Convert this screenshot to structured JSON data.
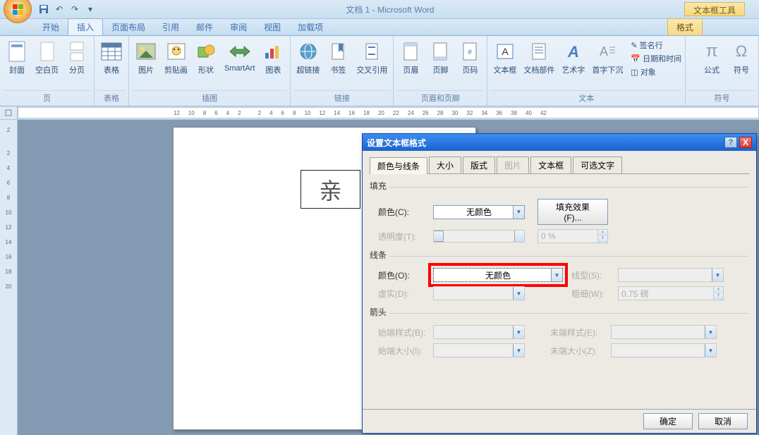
{
  "title": "文档 1 - Microsoft Word",
  "context_tool": "文本框工具",
  "qat": {
    "save": "save-icon",
    "undo": "undo-icon",
    "redo": "redo-icon"
  },
  "tabs": {
    "home": "开始",
    "insert": "插入",
    "layout": "页面布局",
    "ref": "引用",
    "mail": "邮件",
    "review": "审阅",
    "view": "视图",
    "addin": "加载项",
    "format": "格式"
  },
  "ribbon": {
    "groups": {
      "page": {
        "label": "页",
        "items": [
          "封面",
          "空白页",
          "分页"
        ]
      },
      "table": {
        "label": "表格",
        "items": [
          "表格"
        ]
      },
      "illus": {
        "label": "插图",
        "items": [
          "图片",
          "剪贴画",
          "形状",
          "SmartArt",
          "图表"
        ]
      },
      "links": {
        "label": "链接",
        "items": [
          "超链接",
          "书签",
          "交叉引用"
        ]
      },
      "hf": {
        "label": "页眉和页脚",
        "items": [
          "页眉",
          "页脚",
          "页码"
        ]
      },
      "text": {
        "label": "文本",
        "items": [
          "文本框",
          "文档部件",
          "艺术字",
          "首字下沉"
        ],
        "small": [
          "签名行",
          "日期和时间",
          "对象"
        ]
      },
      "sym": {
        "label": "符号",
        "items": [
          "公式",
          "符号"
        ]
      }
    }
  },
  "ruler_h": [
    "12",
    "10",
    "8",
    "6",
    "4",
    "2",
    "",
    "2",
    "4",
    "6",
    "8",
    "10",
    "12",
    "14",
    "16",
    "18",
    "20",
    "22",
    "24",
    "26",
    "28",
    "30",
    "32",
    "34",
    "36",
    "38",
    "40",
    "42"
  ],
  "ruler_v": [
    "2",
    "",
    "2",
    "4",
    "6",
    "8",
    "10",
    "12",
    "14",
    "16",
    "18",
    "20"
  ],
  "doc_textbox": "亲",
  "dialog": {
    "title": "设置文本框格式",
    "help": "?",
    "close": "X",
    "tabs": {
      "colors": "颜色与线条",
      "size": "大小",
      "layout": "版式",
      "picture": "图片",
      "textbox": "文本框",
      "alt": "可选文字"
    },
    "fill": {
      "legend": "填充",
      "color_label": "颜色(C):",
      "color_value": "无颜色",
      "fillfx_btn": "填充效果(F)...",
      "trans_label": "透明度(T):",
      "trans_value": "0 %"
    },
    "line": {
      "legend": "线条",
      "color_label": "颜色(O):",
      "color_value": "无颜色",
      "style_label": "线型(S):",
      "dash_label": "虚实(D):",
      "weight_label": "粗细(W):",
      "weight_value": "0.75 磅"
    },
    "arrow": {
      "legend": "箭头",
      "bstyle_label": "始端样式(B):",
      "estyle_label": "末端样式(E):",
      "bsize_label": "始端大小(I):",
      "esize_label": "末端大小(Z):"
    },
    "ok": "确定",
    "cancel": "取消"
  }
}
